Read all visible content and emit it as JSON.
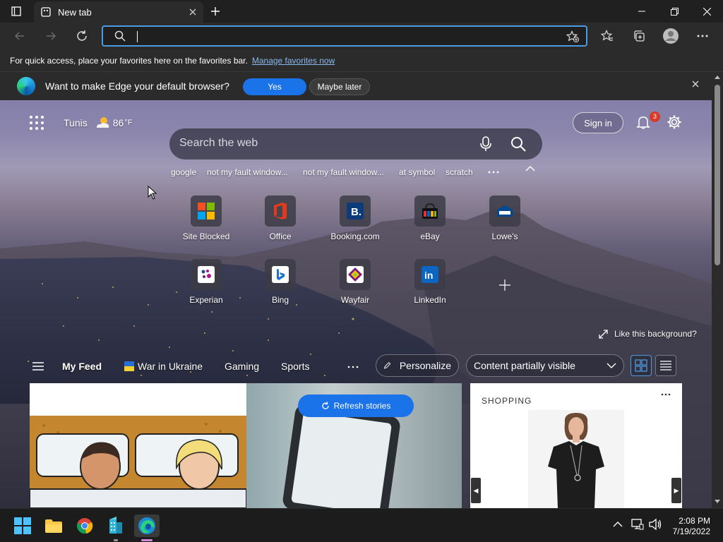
{
  "tab": {
    "title": "New tab"
  },
  "favbar": {
    "text": "For quick access, place your favorites here on the favorites bar.",
    "link": "Manage favorites now"
  },
  "banner": {
    "message": "Want to make Edge your default browser?",
    "yes": "Yes",
    "later": "Maybe later"
  },
  "weather": {
    "city": "Tunis",
    "temp": "86",
    "unit": "°F",
    "icon": "partly-sunny-icon"
  },
  "header": {
    "signin": "Sign in",
    "notifications": "3"
  },
  "search": {
    "placeholder": "Search the web"
  },
  "suggestions": [
    "google",
    "not my fault window...",
    "not my fault window...",
    "at symbol",
    "scratch"
  ],
  "tiles": [
    {
      "label": "Site Blocked",
      "icon": "microsoft-icon"
    },
    {
      "label": "Office",
      "icon": "office-icon"
    },
    {
      "label": "Booking.com",
      "icon": "booking-icon"
    },
    {
      "label": "eBay",
      "icon": "ebay-icon"
    },
    {
      "label": "Lowe's",
      "icon": "lowes-icon"
    },
    {
      "label": "Experian",
      "icon": "experian-icon"
    },
    {
      "label": "Bing",
      "icon": "bing-icon"
    },
    {
      "label": "Wayfair",
      "icon": "wayfair-icon"
    },
    {
      "label": "LinkedIn",
      "icon": "linkedin-icon"
    }
  ],
  "background": {
    "like": "Like this background?"
  },
  "feed": {
    "my_feed": "My Feed",
    "items": [
      "War in Ukraine",
      "Gaming",
      "Sports"
    ],
    "personalize": "Personalize",
    "visibility": "Content partially visible",
    "refresh": "Refresh stories",
    "shopping": "SHOPPING"
  },
  "taskbar": {
    "time": "2:08 PM",
    "date": "7/19/2022"
  },
  "colors": {
    "accent": "#1a73e8",
    "address_border": "#4c9ae0",
    "badge": "#d73a26"
  }
}
